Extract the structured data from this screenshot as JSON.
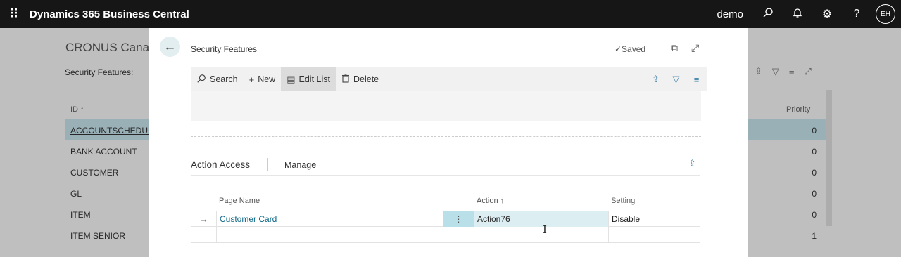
{
  "topbar": {
    "app_title": "Dynamics 365 Business Central",
    "company": "demo",
    "avatar_initials": "EH",
    "icons": [
      "waffle-icon",
      "search-icon",
      "bell-icon",
      "gear-icon",
      "help-icon"
    ]
  },
  "background": {
    "company_name": "CRONUS Canac",
    "caption": "Security Features:",
    "col_id": "ID ↑",
    "col_priority": "Priority",
    "rows": [
      {
        "id": "ACCOUNTSCHEDULI",
        "priority": "0"
      },
      {
        "id": "BANK ACCOUNT",
        "priority": "0"
      },
      {
        "id": "CUSTOMER",
        "priority": "0"
      },
      {
        "id": "GL",
        "priority": "0"
      },
      {
        "id": "ITEM",
        "priority": "0"
      },
      {
        "id": "ITEM SENIOR",
        "priority": "1"
      }
    ]
  },
  "dialog": {
    "title": "Security Features",
    "saved": "✓Saved",
    "toolbar": {
      "search": "Search",
      "new": "New",
      "edit_list": "Edit List",
      "delete": "Delete"
    },
    "part": {
      "title": "Action Access",
      "manage": "Manage",
      "columns": {
        "page_name": "Page Name",
        "action": "Action ↑",
        "setting": "Setting"
      },
      "rows": [
        {
          "page_name": "Customer Card",
          "action": "Action76",
          "setting": "Disable"
        }
      ]
    }
  },
  "colors": {
    "topbar": "#161616",
    "accent": "#0f6a8a",
    "selected_row": "#c4e2ea"
  }
}
